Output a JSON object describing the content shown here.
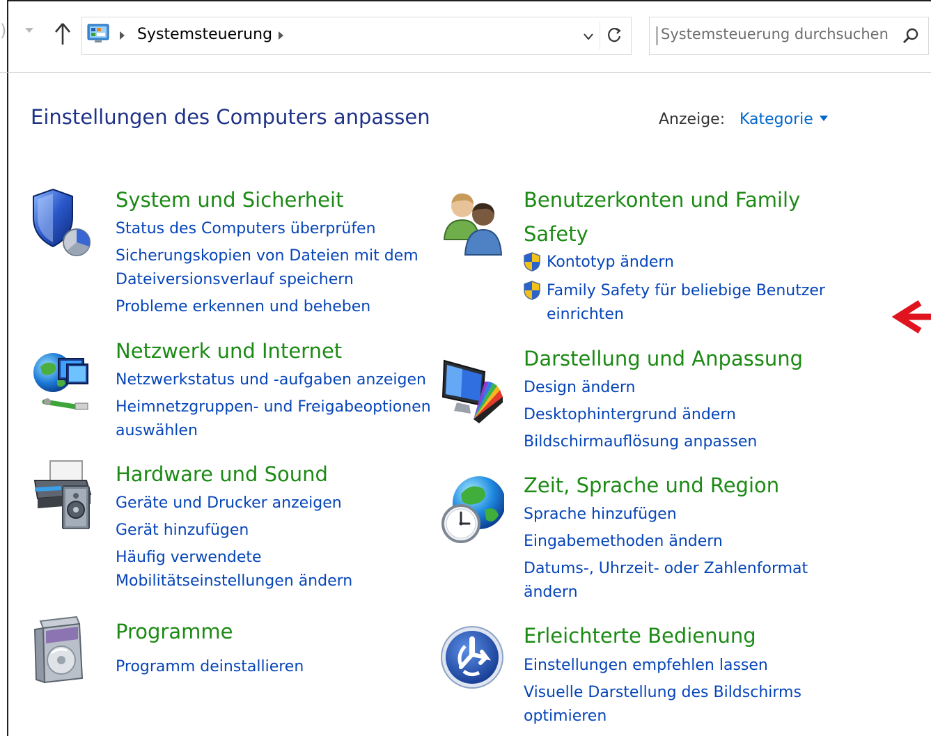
{
  "addressbar": {
    "breadcrumb": "Systemsteuerung",
    "search_placeholder": "Systemsteuerung durchsuchen"
  },
  "header": {
    "title": "Einstellungen des Computers anpassen",
    "view_label": "Anzeige:",
    "view_value": "Kategorie"
  },
  "categories": {
    "system": {
      "title": "System und Sicherheit",
      "icon": "shield-pie-icon",
      "links": [
        "Status des Computers überprüfen",
        "Sicherungskopien von Dateien mit dem",
        "Dateiversionsverlauf speichern",
        "Probleme erkennen und beheben"
      ]
    },
    "network": {
      "title": "Netzwerk und Internet",
      "icon": "globe-network-icon",
      "links": [
        "Netzwerkstatus und -aufgaben anzeigen",
        "Heimnetzgruppen- und Freigabeoptionen",
        "auswählen"
      ]
    },
    "hardware": {
      "title": "Hardware und Sound",
      "icon": "printer-speaker-icon",
      "links": [
        "Geräte und Drucker anzeigen",
        "Gerät hinzufügen",
        "Häufig verwendete",
        "Mobilitätseinstellungen ändern"
      ]
    },
    "programs": {
      "title": "Programme",
      "icon": "software-box-icon",
      "links": [
        "Programm deinstallieren"
      ]
    },
    "users": {
      "title_line1": "Benutzerkonten und Family",
      "title_line2": "Safety",
      "icon": "users-icon",
      "links": [
        "Kontotyp ändern",
        "Family Safety für beliebige Benutzer",
        "einrichten"
      ]
    },
    "appearance": {
      "title": "Darstellung und Anpassung",
      "icon": "monitor-palette-icon",
      "links": [
        "Design ändern",
        "Desktophintergrund ändern",
        "Bildschirmauflösung anpassen"
      ]
    },
    "region": {
      "title": "Zeit, Sprache und Region",
      "icon": "globe-clock-icon",
      "links": [
        "Sprache hinzufügen",
        "Eingabemethoden ändern",
        "Datums-, Uhrzeit- oder Zahlenformat",
        "ändern"
      ]
    },
    "access": {
      "title": "Erleichterte Bedienung",
      "icon": "accessibility-icon",
      "links": [
        "Einstellungen empfehlen lassen",
        "Visuelle Darstellung des Bildschirms",
        "optimieren"
      ]
    }
  },
  "colors": {
    "title_blue": "#1e3287",
    "category_green": "#1c8a14",
    "link_blue": "#0645b8",
    "annotation_red": "#e0141e"
  }
}
